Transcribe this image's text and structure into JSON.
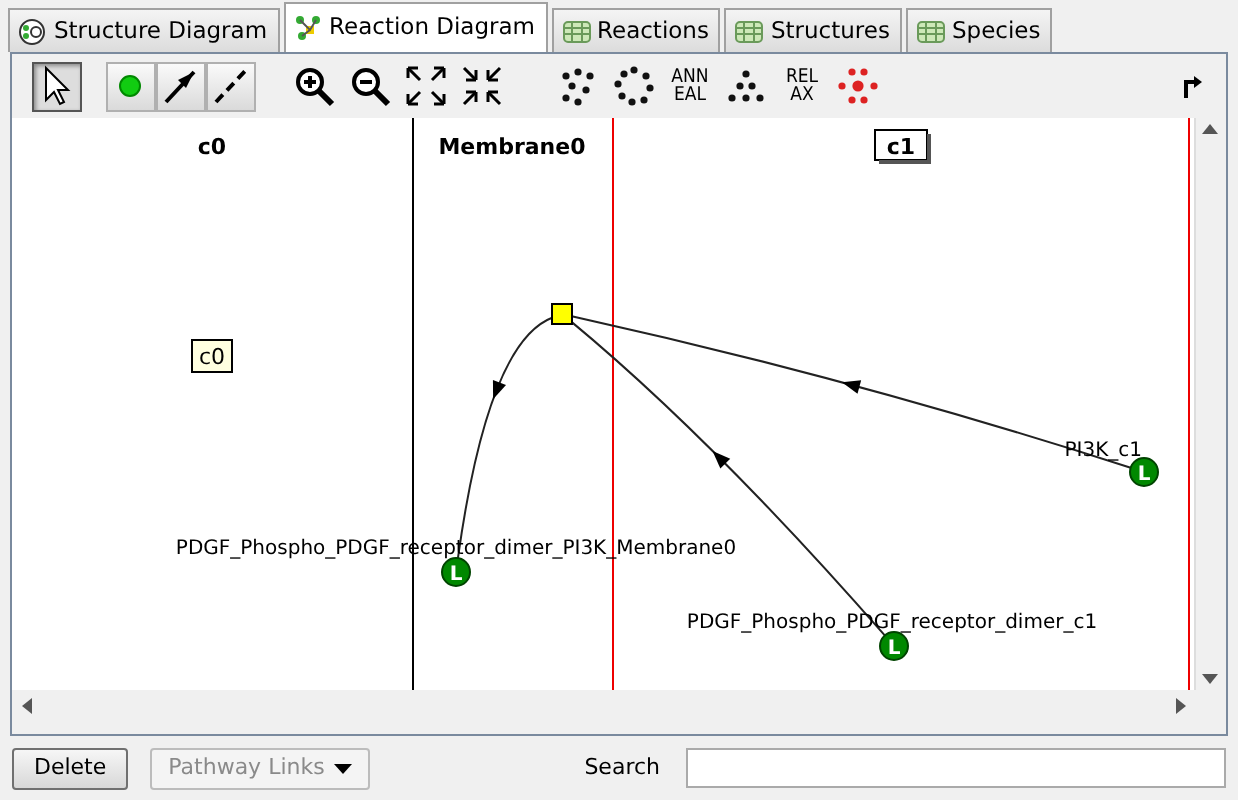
{
  "tabs": [
    {
      "label": "Structure Diagram",
      "kind": "structure",
      "selected": false
    },
    {
      "label": "Reaction Diagram",
      "kind": "reaction",
      "selected": true
    },
    {
      "label": "Reactions",
      "kind": "table",
      "selected": false
    },
    {
      "label": "Structures",
      "kind": "table",
      "selected": false
    },
    {
      "label": "Species",
      "kind": "table",
      "selected": false
    }
  ],
  "toolbar": [
    {
      "kind": "select",
      "selected": true
    },
    {
      "kind": "species",
      "selected": false
    },
    {
      "kind": "reaction",
      "selected": false
    },
    {
      "kind": "flux",
      "selected": false
    },
    {
      "kind": "zoom-in"
    },
    {
      "kind": "zoom-out"
    },
    {
      "kind": "expand"
    },
    {
      "kind": "shrink"
    },
    {
      "kind": "random"
    },
    {
      "kind": "circle"
    },
    {
      "kind": "text",
      "lines": [
        "ANN",
        "EAL"
      ]
    },
    {
      "kind": "grid"
    },
    {
      "kind": "text",
      "lines": [
        "REL",
        "AX"
      ]
    },
    {
      "kind": "glg"
    }
  ],
  "diagram": {
    "compartments": [
      {
        "name": "c0",
        "selected": false
      },
      {
        "name": "Membrane0",
        "selected": false
      },
      {
        "name": "c1",
        "selected": true
      }
    ],
    "structure_labels": [
      {
        "text": "c0"
      }
    ],
    "species": [
      {
        "name": "PI3K_c1",
        "badge": "L"
      },
      {
        "name": "PDGF_Phospho_PDGF_receptor_dimer_PI3K_Membrane0",
        "badge": "L"
      },
      {
        "name": "PDGF_Phospho_PDGF_receptor_dimer_c1",
        "badge": "L"
      }
    ]
  },
  "bottom": {
    "delete_button": "Delete",
    "pathway_button": {
      "label": "Pathway Links",
      "disabled": true
    },
    "search": {
      "label": "Search"
    }
  }
}
